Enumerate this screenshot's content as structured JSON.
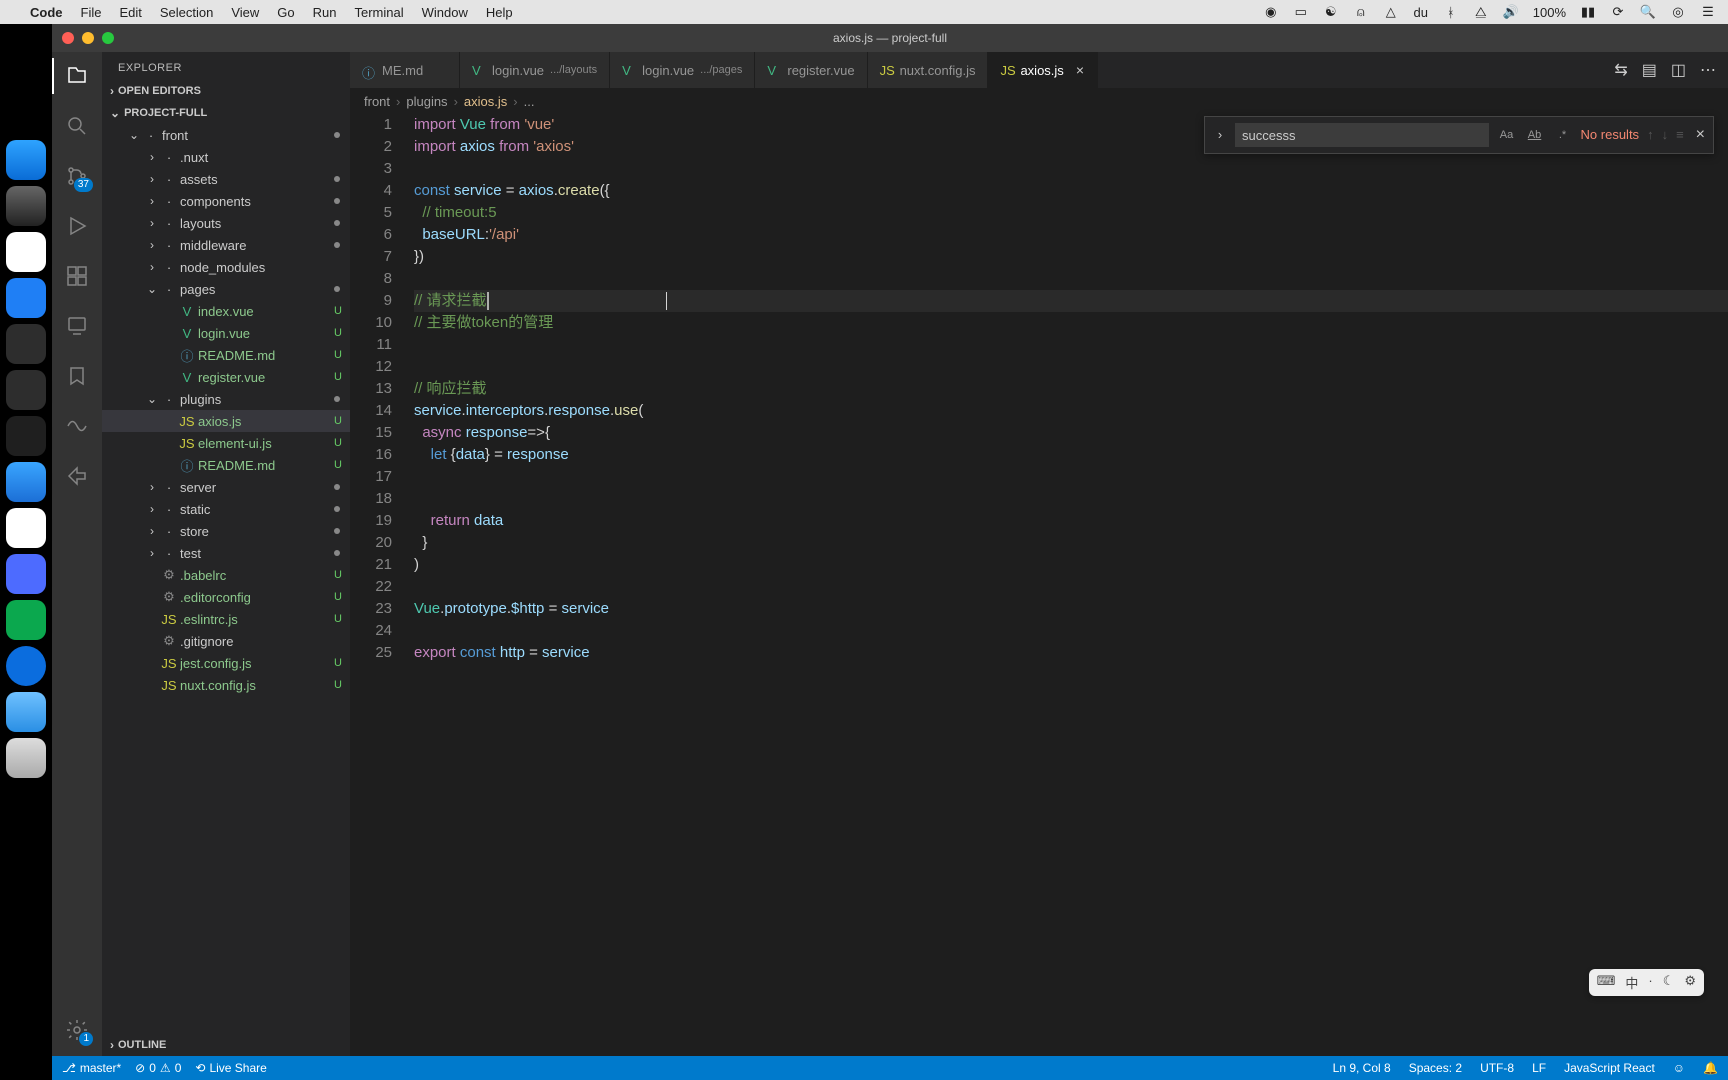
{
  "menubar": {
    "app": "Code",
    "items": [
      "File",
      "Edit",
      "Selection",
      "View",
      "Go",
      "Run",
      "Terminal",
      "Window",
      "Help"
    ],
    "time": "",
    "battery": "100%"
  },
  "window": {
    "title": "axios.js — project-full"
  },
  "activitybar": {
    "scm_badge": "37",
    "gear_badge": "1"
  },
  "sidebar": {
    "title": "EXPLORER",
    "sections": {
      "open_editors": "OPEN EDITORS",
      "project": "PROJECT-FULL",
      "outline": "OUTLINE"
    },
    "tree": [
      {
        "label": "front",
        "type": "folder",
        "expanded": true,
        "indent": 1,
        "dot": true
      },
      {
        "label": ".nuxt",
        "type": "folder",
        "indent": 2
      },
      {
        "label": "assets",
        "type": "folder",
        "indent": 2,
        "dot": true
      },
      {
        "label": "components",
        "type": "folder",
        "indent": 2,
        "dot": true
      },
      {
        "label": "layouts",
        "type": "folder",
        "indent": 2,
        "dot": true
      },
      {
        "label": "middleware",
        "type": "folder",
        "indent": 2,
        "dot": true
      },
      {
        "label": "node_modules",
        "type": "folder",
        "indent": 2
      },
      {
        "label": "pages",
        "type": "folder",
        "expanded": true,
        "indent": 2,
        "dot": true
      },
      {
        "label": "index.vue",
        "type": "vue",
        "indent": 3,
        "git": "U"
      },
      {
        "label": "login.vue",
        "type": "vue",
        "indent": 3,
        "git": "U"
      },
      {
        "label": "README.md",
        "type": "md",
        "indent": 3,
        "git": "U"
      },
      {
        "label": "register.vue",
        "type": "vue",
        "indent": 3,
        "git": "U"
      },
      {
        "label": "plugins",
        "type": "folder",
        "expanded": true,
        "indent": 2,
        "dot": true
      },
      {
        "label": "axios.js",
        "type": "js",
        "indent": 3,
        "git": "U",
        "selected": true
      },
      {
        "label": "element-ui.js",
        "type": "js",
        "indent": 3,
        "git": "U"
      },
      {
        "label": "README.md",
        "type": "md",
        "indent": 3,
        "git": "U"
      },
      {
        "label": "server",
        "type": "folder",
        "indent": 2,
        "dot": true
      },
      {
        "label": "static",
        "type": "folder",
        "indent": 2,
        "dot": true
      },
      {
        "label": "store",
        "type": "folder",
        "indent": 2,
        "dot": true
      },
      {
        "label": "test",
        "type": "folder",
        "indent": 2,
        "dot": true
      },
      {
        "label": ".babelrc",
        "type": "file",
        "indent": 2,
        "git": "U"
      },
      {
        "label": ".editorconfig",
        "type": "file",
        "indent": 2,
        "git": "U"
      },
      {
        "label": ".eslintrc.js",
        "type": "js",
        "indent": 2,
        "git": "U"
      },
      {
        "label": ".gitignore",
        "type": "file",
        "indent": 2
      },
      {
        "label": "jest.config.js",
        "type": "js",
        "indent": 2,
        "git": "U"
      },
      {
        "label": "nuxt.config.js",
        "type": "js",
        "indent": 2,
        "git": "U"
      }
    ]
  },
  "tabs": [
    {
      "label": "ME.md",
      "icon": "md",
      "sub": ""
    },
    {
      "label": "login.vue",
      "icon": "vue",
      "sub": ".../layouts"
    },
    {
      "label": "login.vue",
      "icon": "vue",
      "sub": ".../pages"
    },
    {
      "label": "register.vue",
      "icon": "vue",
      "sub": ""
    },
    {
      "label": "nuxt.config.js",
      "icon": "js",
      "sub": ""
    },
    {
      "label": "axios.js",
      "icon": "js",
      "sub": "",
      "active": true
    }
  ],
  "breadcrumb": [
    "front",
    "plugins",
    "axios.js",
    "..."
  ],
  "find": {
    "value": "successs",
    "result": "No results"
  },
  "code_lines": [
    {
      "n": 1,
      "html": "<span class='k-import'>import</span> <span class='s-type'>Vue</span> <span class='k-from'>from</span> <span class='s-str'>'vue'</span>"
    },
    {
      "n": 2,
      "html": "<span class='k-import'>import</span> <span class='s-var'>axios</span> <span class='k-from'>from</span> <span class='s-str'>'axios'</span>"
    },
    {
      "n": 3,
      "html": ""
    },
    {
      "n": 4,
      "html": "<span class='k-const'>const</span> <span class='s-var'>service</span> <span class='s-op'>=</span> <span class='s-var'>axios</span>.<span class='s-fn'>create</span>({"
    },
    {
      "n": 5,
      "html": "  <span class='s-cmt'>// timeout:5</span>"
    },
    {
      "n": 6,
      "html": "  <span class='s-prop'>baseURL</span>:<span class='s-str'>'/api'</span>"
    },
    {
      "n": 7,
      "html": "})"
    },
    {
      "n": 8,
      "html": ""
    },
    {
      "n": 9,
      "html": "<span class='s-cmt'>// 请求拦截</span><span class='cursor'></span>",
      "current": true
    },
    {
      "n": 10,
      "html": "<span class='s-cmt'>// 主要做token的管理</span>"
    },
    {
      "n": 11,
      "html": ""
    },
    {
      "n": 12,
      "html": ""
    },
    {
      "n": 13,
      "html": "<span class='s-cmt'>// 响应拦截</span>"
    },
    {
      "n": 14,
      "html": "<span class='s-var'>service</span>.<span class='s-prop'>interceptors</span>.<span class='s-prop'>response</span>.<span class='s-fn'>use</span>("
    },
    {
      "n": 15,
      "html": "  <span class='k-async'>async</span> <span class='s-var'>response</span>=>{"
    },
    {
      "n": 16,
      "html": "    <span class='k-let'>let</span> {<span class='s-var'>data</span>} <span class='s-op'>=</span> <span class='s-var'>response</span>"
    },
    {
      "n": 17,
      "html": ""
    },
    {
      "n": 18,
      "html": ""
    },
    {
      "n": 19,
      "html": "    <span class='k-return'>return</span> <span class='s-var'>data</span>"
    },
    {
      "n": 20,
      "html": "  }"
    },
    {
      "n": 21,
      "html": ")"
    },
    {
      "n": 22,
      "html": ""
    },
    {
      "n": 23,
      "html": "<span class='s-type'>Vue</span>.<span class='s-prop'>prototype</span>.<span class='s-prop'>$http</span> <span class='s-op'>=</span> <span class='s-var'>service</span>"
    },
    {
      "n": 24,
      "html": ""
    },
    {
      "n": 25,
      "html": "<span class='k-export'>export</span> <span class='k-const'>const</span> <span class='s-var'>http</span> <span class='s-op'>=</span> <span class='s-var'>service</span>"
    }
  ],
  "statusbar": {
    "branch": "master*",
    "errors": "0",
    "warnings": "0",
    "liveshare": "Live Share",
    "cursor": "Ln 9, Col 8",
    "spaces": "Spaces: 2",
    "encoding": "UTF-8",
    "eol": "LF",
    "lang": "JavaScript React"
  },
  "float_pill": [
    "⌨",
    "中",
    "·",
    "☾",
    "⚙"
  ]
}
